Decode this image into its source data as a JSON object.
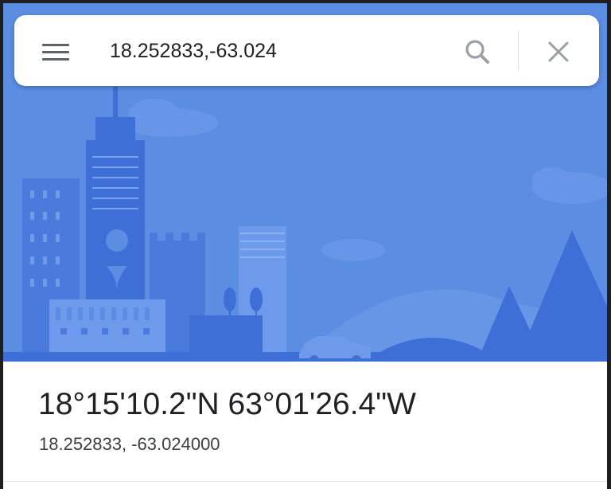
{
  "search": {
    "query": "18.252833,-63.024",
    "menu_icon": "menu-icon",
    "search_icon": "search-icon",
    "close_icon": "close-icon"
  },
  "place": {
    "dms": "18°15'10.2\"N 63°01'26.4\"W",
    "decimal": "18.252833, -63.024000"
  },
  "colors": {
    "hero_background": "#5b8de3",
    "building_dark": "#3d6fd6",
    "building_mid": "#4a7bdc",
    "icon_gray": "#5f6368",
    "text_primary": "#202124"
  }
}
